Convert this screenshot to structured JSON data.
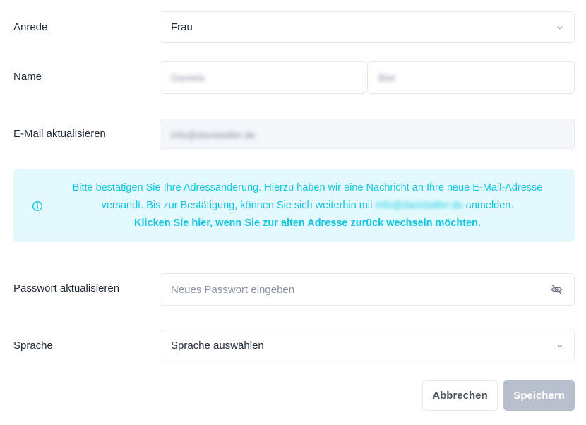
{
  "form": {
    "salutation": {
      "label": "Anrede",
      "value": "Frau"
    },
    "name": {
      "label": "Name",
      "first": "Daniela",
      "last": "Bier"
    },
    "email": {
      "label": "E-Mail aktualisieren",
      "value": "info@danistaller.de"
    },
    "notice": {
      "text_line1": "Bitte bestätigen Sie Ihre Adressänderung. Hierzu haben wir eine Nachricht an Ihre neue E-Mail-Adresse",
      "text_line2_prefix": "versandt. Bis zur Bestätigung, können Sie sich weiterhin mit",
      "old_email": "info@danistaller.de",
      "text_line2_suffix": "anmelden.",
      "link": "Klicken Sie hier, wenn Sie zur alten Adresse zurück wechseln möchten.",
      "icon": "info-icon"
    },
    "password": {
      "label": "Passwort aktualisieren",
      "placeholder": "Neues Passwort eingeben",
      "icon": "eye-off-icon"
    },
    "language": {
      "label": "Sprache",
      "value": "Sprache auswählen"
    }
  },
  "actions": {
    "cancel": "Abbrechen",
    "save": "Speichern"
  },
  "colors": {
    "accent": "#12c5e0",
    "notice_bg": "#e3f9fc",
    "save_disabled": "#b6bfcb"
  }
}
